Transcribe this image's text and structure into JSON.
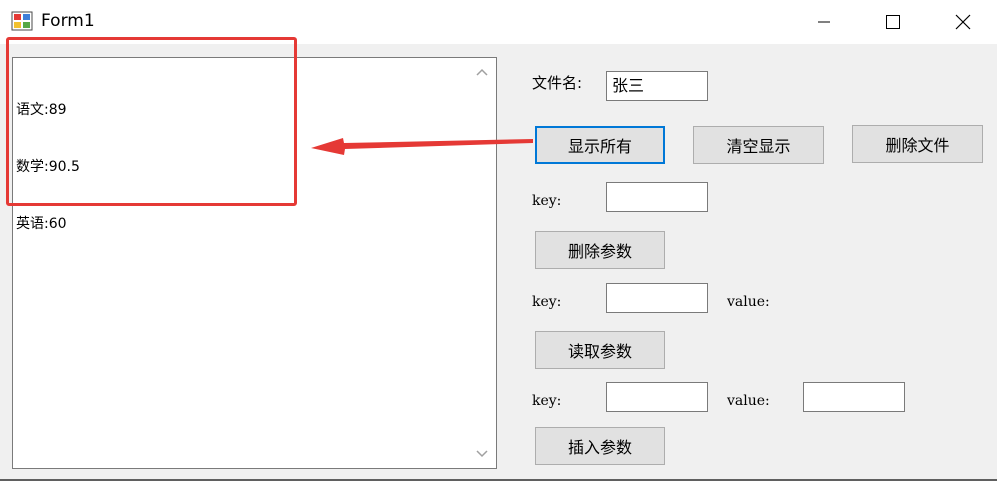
{
  "window": {
    "title": "Form1",
    "minimize_icon": "minimize-icon",
    "maximize_icon": "maximize-icon",
    "close_icon": "close-icon"
  },
  "listbox": {
    "lines": [
      "语文:89",
      "数学:90.5",
      "英语:60"
    ]
  },
  "form": {
    "filename_label": "文件名:",
    "filename_value": "张三",
    "show_all_button": "显示所有",
    "clear_display_button": "清空显示",
    "delete_file_button": "删除文件",
    "delete_section": {
      "key_label": "key:",
      "key_value": "",
      "button": "删除参数"
    },
    "read_section": {
      "key_label": "key:",
      "key_value": "",
      "value_label": "value:",
      "button": "读取参数"
    },
    "insert_section": {
      "key_label": "key:",
      "key_value": "",
      "value_label": "value:",
      "value_value": "",
      "button": "插入参数"
    }
  },
  "annotation": {
    "highlight_color": "#e53935",
    "primary_color": "#0078d7"
  }
}
